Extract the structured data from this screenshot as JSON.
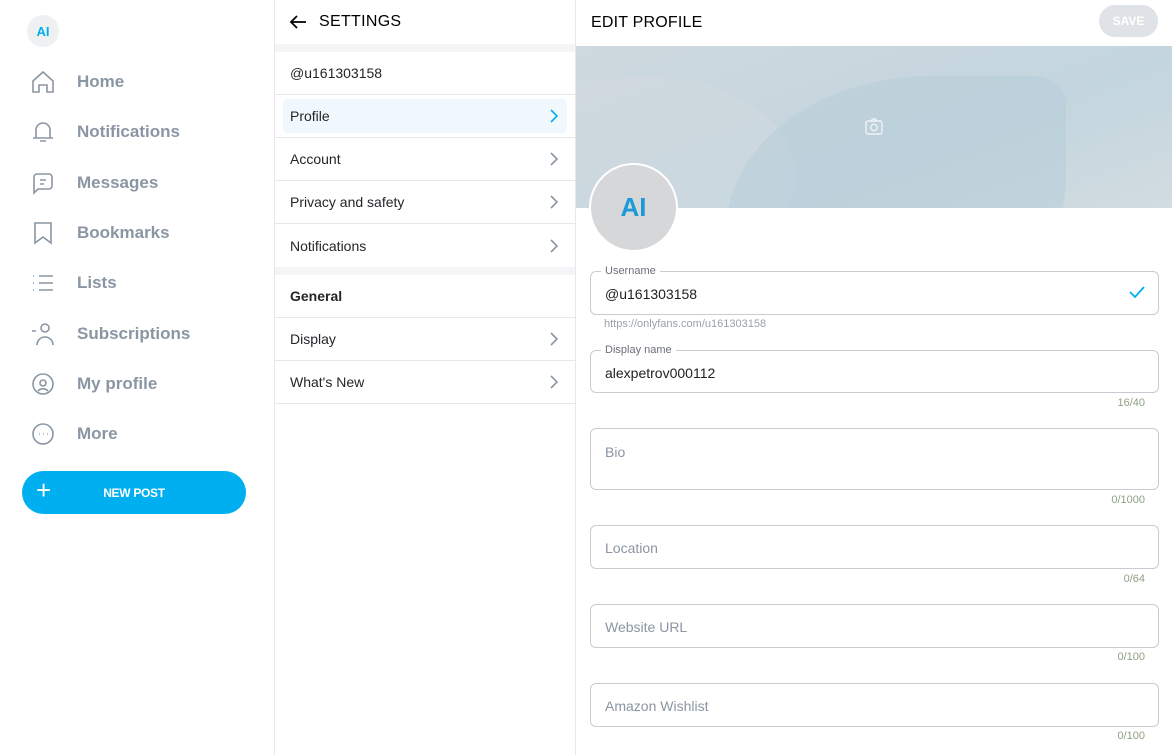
{
  "sidebar": {
    "logo": "AI",
    "items": [
      {
        "label": "Home",
        "icon": "home-icon"
      },
      {
        "label": "Notifications",
        "icon": "bell-icon"
      },
      {
        "label": "Messages",
        "icon": "message-icon"
      },
      {
        "label": "Bookmarks",
        "icon": "bookmark-icon"
      },
      {
        "label": "Lists",
        "icon": "list-icon"
      },
      {
        "label": "Subscriptions",
        "icon": "subscriptions-icon"
      },
      {
        "label": "My profile",
        "icon": "profile-icon"
      },
      {
        "label": "More",
        "icon": "more-icon"
      }
    ],
    "new_post": "NEW POST"
  },
  "settings": {
    "title": "SETTINGS",
    "account": "@u161303158",
    "items": [
      "Profile",
      "Account",
      "Privacy and safety",
      "Notifications"
    ],
    "general_header": "General",
    "general_items": [
      "Display",
      "What's New"
    ]
  },
  "edit": {
    "title": "EDIT PROFILE",
    "save": "SAVE",
    "avatar_text": "AI",
    "username_label": "Username",
    "username": "@u161303158",
    "profile_url": "https://onlyfans.com/u161303158",
    "display_label": "Display name",
    "display_name": "alexpetrov000112",
    "display_counter": "16/40",
    "bio_placeholder": "Bio",
    "bio_counter": "0/1000",
    "location_placeholder": "Location",
    "location_counter": "0/64",
    "website_placeholder": "Website URL",
    "website_counter": "0/100",
    "wishlist_placeholder": "Amazon Wishlist",
    "wishlist_counter": "0/100"
  },
  "colors": {
    "accent": "#00aff0",
    "muted": "#8a96a3"
  }
}
